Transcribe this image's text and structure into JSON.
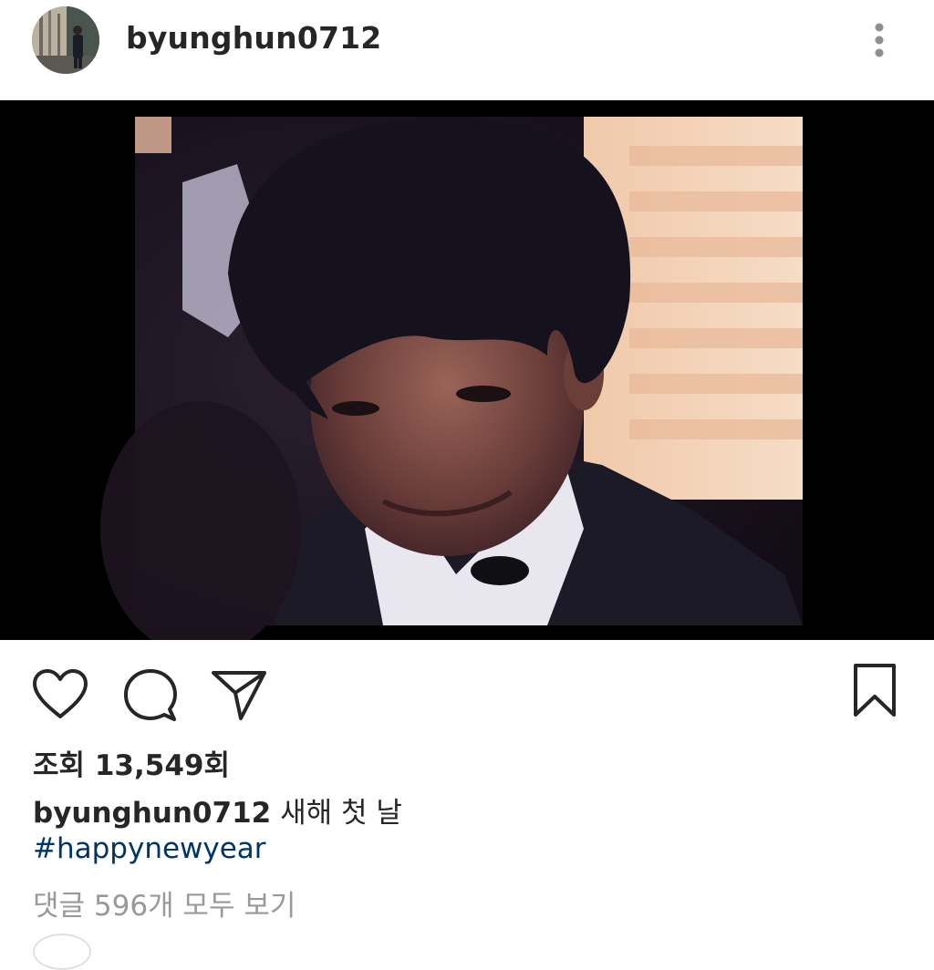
{
  "post": {
    "username": "byunghun0712",
    "caption_text": "새해 첫 날",
    "hashtag": "#happynewyear",
    "views_label": "조회 13,549회",
    "view_comments_label": "댓글 596개 모두 보기"
  },
  "icons": {
    "more": "more-vertical-icon",
    "like": "heart-icon",
    "comment": "comment-bubble-icon",
    "share": "paper-plane-icon",
    "save": "bookmark-icon"
  },
  "colors": {
    "text": "#262626",
    "hashtag": "#003569",
    "muted": "#999999",
    "more_dots": "#8e8e8e",
    "media_bg": "#000000"
  }
}
